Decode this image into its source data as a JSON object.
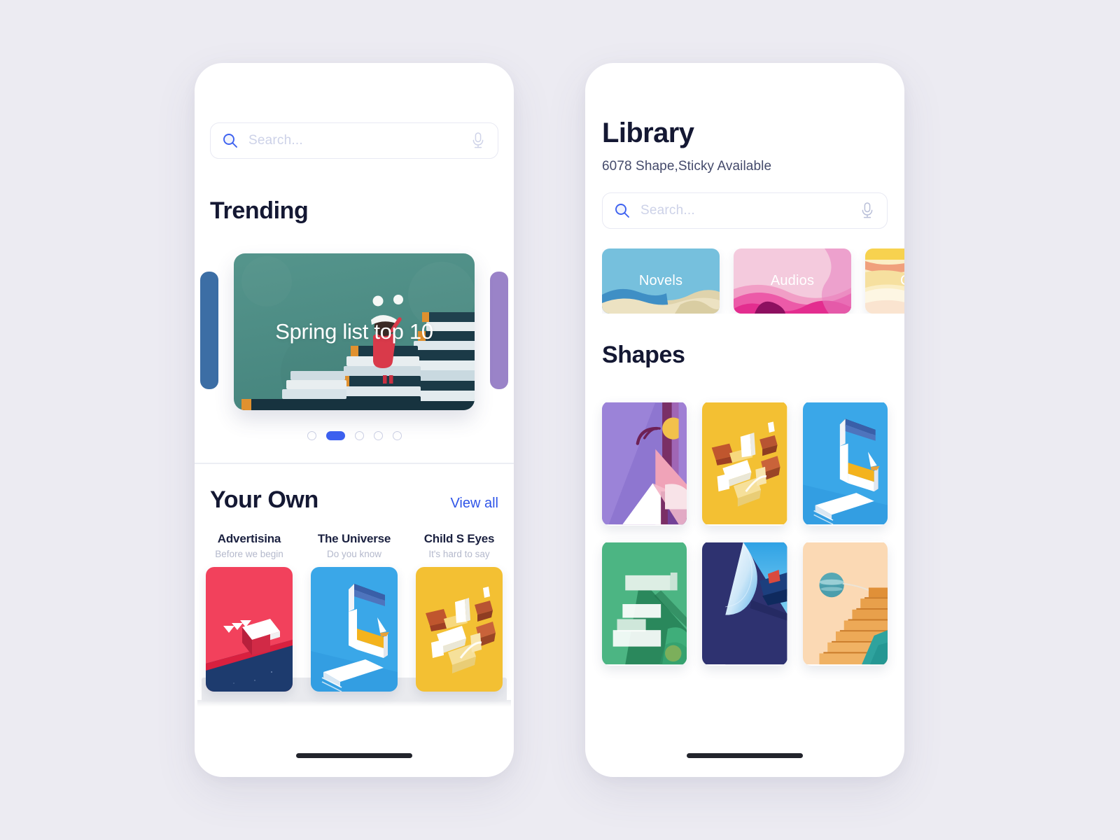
{
  "canvas": {
    "background": "#ecebf2"
  },
  "left_phone": {
    "search": {
      "placeholder": "Search...",
      "value": "",
      "search_icon": "search-icon",
      "mic_icon": "microphone-icon"
    },
    "trending": {
      "heading": "Trending",
      "hero_caption": "Spring list top 10",
      "hero_illustration": "girl-standing-on-book-stacks",
      "hero_bg": "#4f9289",
      "peek_left_color": "#3c6ea5",
      "peek_right_color": "#9a83c8",
      "dots": {
        "count": 5,
        "active_index": 1,
        "active_color": "#3d61f0",
        "inactive_color": "#ccd0e4"
      }
    },
    "your_own": {
      "heading": "Your Own",
      "view_all_label": "View all",
      "view_all_color": "#2f55e8",
      "items": [
        {
          "title": "Advertisina",
          "subtitle": "Before we begin",
          "cover": "red-isometric-ramp",
          "color": "#f2415c"
        },
        {
          "title": "The Universe",
          "subtitle": "Do you know",
          "cover": "blue-isometric-window-sailboat",
          "color": "#3aa7e8"
        },
        {
          "title": "Child S Eyes",
          "subtitle": "It's hard to say",
          "cover": "yellow-abstract-shards",
          "color": "#f3c033"
        }
      ]
    },
    "home_indicator": "home-indicator"
  },
  "right_phone": {
    "title": "Library",
    "subtitle": "6078 Shape,Sticky Available",
    "search": {
      "placeholder": "Search...",
      "value": "",
      "search_icon": "search-icon",
      "mic_icon": "microphone-icon"
    },
    "categories": [
      {
        "label": "Novels",
        "color": "#76c0dd",
        "cut": false
      },
      {
        "label": "Audios",
        "color": "#f3b3cd",
        "cut": false
      },
      {
        "label": "C",
        "color": "#f7d24f",
        "cut": true
      }
    ],
    "shapes_heading": "Shapes",
    "shapes": [
      {
        "name": "purple-tree-triangle",
        "color": "#8e76d0"
      },
      {
        "name": "yellow-abstract-shards",
        "color": "#f3c033"
      },
      {
        "name": "blue-isometric-window-sailboat",
        "color": "#3aa7e8"
      },
      {
        "name": "green-isometric-shelves",
        "color": "#4cb583"
      },
      {
        "name": "navy-page-curl-ship",
        "color": "#2e3270"
      },
      {
        "name": "peach-stairs-planet",
        "color": "#fbd9b4"
      }
    ],
    "home_indicator": "home-indicator"
  }
}
